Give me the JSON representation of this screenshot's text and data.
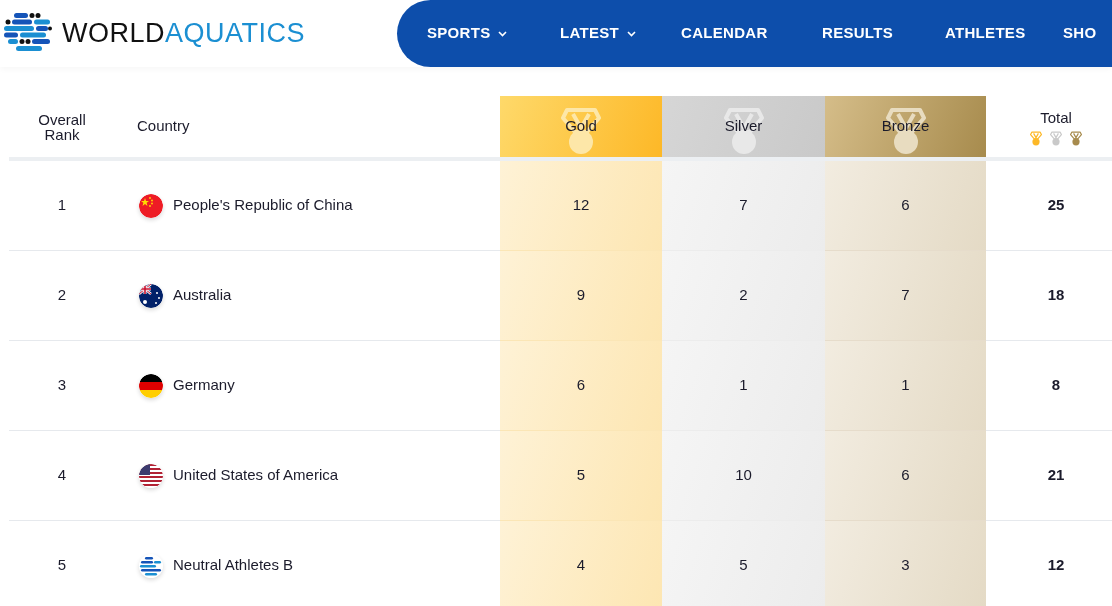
{
  "logo": {
    "first_word": "WORLD",
    "second_word": "AQUATICS"
  },
  "nav": [
    {
      "label": "SPORTS",
      "has_menu": true
    },
    {
      "label": "LATEST",
      "has_menu": true
    },
    {
      "label": "CALENDAR",
      "has_menu": false
    },
    {
      "label": "RESULTS",
      "has_menu": false
    },
    {
      "label": "ATHLETES",
      "has_menu": false
    },
    {
      "label": "SHO",
      "has_menu": false
    }
  ],
  "table": {
    "columns": [
      {
        "label": "Overall Rank",
        "kind": "rank"
      },
      {
        "label": "Country",
        "kind": "country"
      },
      {
        "label": "Gold",
        "kind": "gold"
      },
      {
        "label": "Silver",
        "kind": "silver"
      },
      {
        "label": "Bronze",
        "kind": "bronze"
      },
      {
        "label": "Total",
        "kind": "total"
      }
    ],
    "rows": [
      {
        "rank": "1",
        "kind": "china",
        "country": "People's Republic of China",
        "gold": "12",
        "silver": "7",
        "bronze": "6",
        "total": "25"
      },
      {
        "rank": "2",
        "kind": "australia",
        "country": "Australia",
        "gold": "9",
        "silver": "2",
        "bronze": "7",
        "total": "18"
      },
      {
        "rank": "3",
        "kind": "germany",
        "country": "Germany",
        "gold": "6",
        "silver": "1",
        "bronze": "1",
        "total": "8"
      },
      {
        "rank": "4",
        "kind": "usa",
        "country": "United States of America",
        "gold": "5",
        "silver": "10",
        "bronze": "6",
        "total": "21"
      },
      {
        "rank": "5",
        "kind": "neutral",
        "country": "Neutral Athletes B",
        "gold": "4",
        "silver": "5",
        "bronze": "3",
        "total": "12"
      }
    ]
  }
}
